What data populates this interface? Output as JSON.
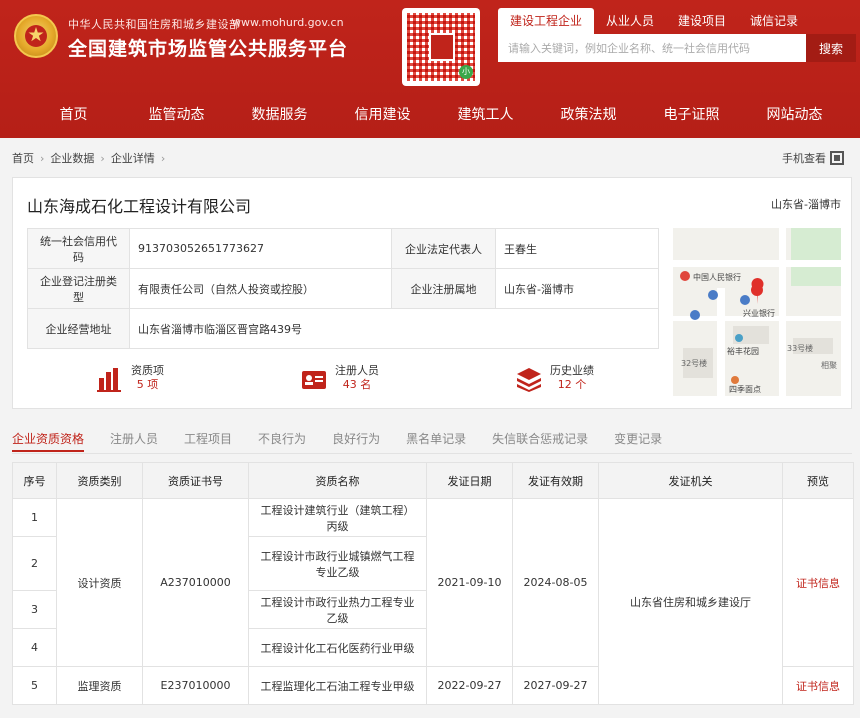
{
  "header": {
    "ministry": "中华人民共和国住房和城乡建设部",
    "site_url": "www.mohurd.gov.cn",
    "platform_title": "全国建筑市场监管公共服务平台",
    "search_tabs": [
      "建设工程企业",
      "从业人员",
      "建设项目",
      "诚信记录"
    ],
    "search_placeholder": "请输入关键词，例如企业名称、统一社会信用代码",
    "search_button": "搜索",
    "nav": [
      "首页",
      "监管动态",
      "数据服务",
      "信用建设",
      "建筑工人",
      "政策法规",
      "电子证照",
      "网站动态"
    ]
  },
  "breadcrumb": [
    "首页",
    "企业数据",
    "企业详情"
  ],
  "mobile_view": "手机查看",
  "company": {
    "name": "山东海成石化工程设计有限公司",
    "region": "山东省-淄博市",
    "credit_code_label": "统一社会信用代码",
    "credit_code": "913703052651773627",
    "legal_rep_label": "企业法定代表人",
    "legal_rep": "王春生",
    "reg_type_label": "企业登记注册类型",
    "reg_type": "有限责任公司（自然人投资或控股）",
    "reg_place_label": "企业注册属地",
    "reg_place": "山东省-淄博市",
    "address_label": "企业经营地址",
    "address": "山东省淄博市临淄区晋宫路439号"
  },
  "map": {
    "labels": [
      "中国人民银行",
      "兴业银行",
      "裕丰花园",
      "四季面点",
      "33号楼",
      "相聚",
      "32号楼"
    ]
  },
  "stats": [
    {
      "label": "资质项",
      "value": "5 项"
    },
    {
      "label": "注册人员",
      "value": "43 名"
    },
    {
      "label": "历史业绩",
      "value": "12 个"
    }
  ],
  "tabs": [
    "企业资质资格",
    "注册人员",
    "工程项目",
    "不良行为",
    "良好行为",
    "黑名单记录",
    "失信联合惩戒记录",
    "变更记录"
  ],
  "qual_table": {
    "headers": [
      "序号",
      "资质类别",
      "资质证书号",
      "资质名称",
      "发证日期",
      "发证有效期",
      "发证机关",
      "预览"
    ],
    "rows": [
      {
        "no": "1",
        "name": "工程设计建筑行业（建筑工程）丙级"
      },
      {
        "no": "2",
        "name": "工程设计市政行业城镇燃气工程专业乙级"
      },
      {
        "no": "3",
        "name": "工程设计市政行业热力工程专业乙级"
      },
      {
        "no": "4",
        "name": "工程设计化工石化医药行业甲级"
      },
      {
        "no": "5",
        "name": "工程监理化工石油工程专业甲级"
      }
    ],
    "group1": {
      "category": "设计资质",
      "cert_no": "A237010000",
      "issue_date": "2021-09-10",
      "valid_until": "2024-08-05",
      "preview": "证书信息"
    },
    "group2": {
      "category": "监理资质",
      "cert_no": "E237010000",
      "issue_date": "2022-09-27",
      "valid_until": "2027-09-27",
      "preview": "证书信息"
    },
    "authority": "山东省住房和城乡建设厅"
  },
  "colors": {
    "brand_red": "#c0241b",
    "link_red": "#c0241b"
  }
}
